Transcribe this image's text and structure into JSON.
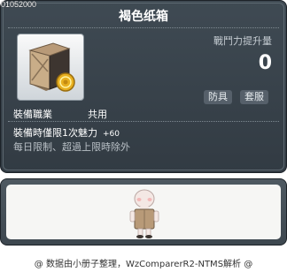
{
  "item": {
    "id": "01052000",
    "name": "褐色纸箱",
    "icon": "brown-box-with-gold-coin",
    "power_label": "戰鬥力提升量",
    "power_value": "0",
    "tags": [
      "防具",
      "套服"
    ],
    "job_label": "裝備職業",
    "job_value": "共用",
    "requirement_text": "裝備時僅限1次魅力",
    "bonus_text": "+60",
    "limit_text": "每日限制、超過上限時除外"
  },
  "preview": {
    "character": "plain-avatar-wearing-box"
  },
  "credit": "@ 数据由小册子整理，WzComparerR2-NTMS解析 @",
  "colors": {
    "panel": "#3a444c",
    "accent_gold": "#e8b020",
    "box_brown": "#b89a78"
  }
}
